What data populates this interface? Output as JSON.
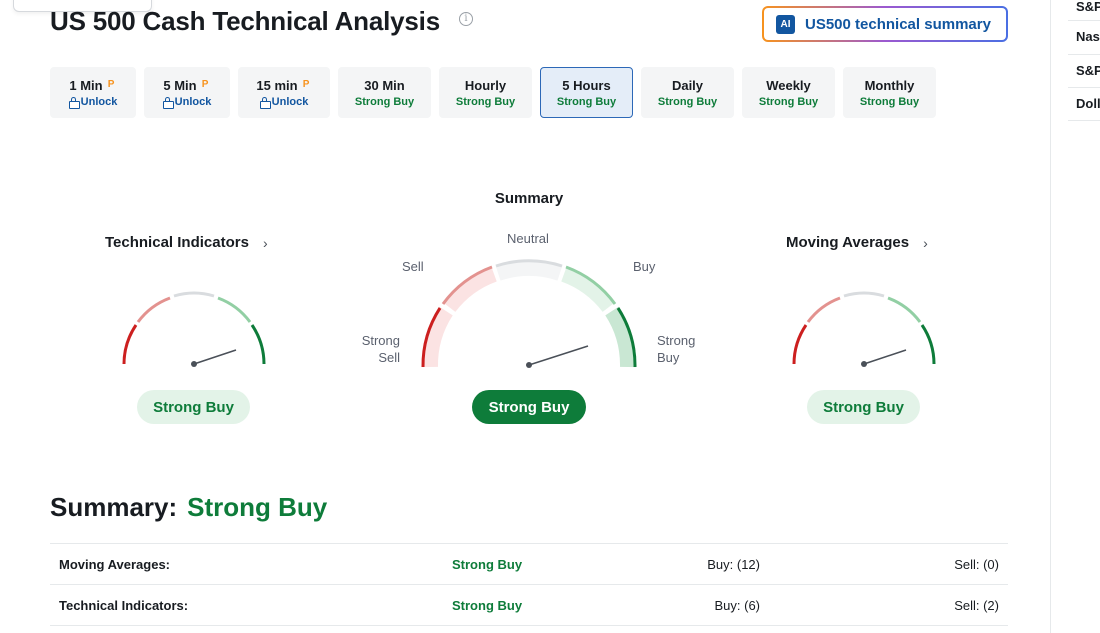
{
  "page": {
    "title": "US 500 Cash Technical Analysis",
    "info_icon": "info-icon"
  },
  "ai_summary": {
    "badge": "AI",
    "label": "US500 technical summary"
  },
  "colors": {
    "strong_buy": "#0e7c3a",
    "link_blue": "#1256a0",
    "pro_orange": "#f7931e"
  },
  "timeframes": [
    {
      "label": "1 Min",
      "status": "Unlock",
      "locked": true,
      "active": false
    },
    {
      "label": "5 Min",
      "status": "Unlock",
      "locked": true,
      "active": false
    },
    {
      "label": "15 min",
      "status": "Unlock",
      "locked": true,
      "active": false
    },
    {
      "label": "30 Min",
      "status": "Strong Buy",
      "locked": false,
      "active": false
    },
    {
      "label": "Hourly",
      "status": "Strong Buy",
      "locked": false,
      "active": false
    },
    {
      "label": "5 Hours",
      "status": "Strong Buy",
      "locked": false,
      "active": true
    },
    {
      "label": "Daily",
      "status": "Strong Buy",
      "locked": false,
      "active": false
    },
    {
      "label": "Weekly",
      "status": "Strong Buy",
      "locked": false,
      "active": false
    },
    {
      "label": "Monthly",
      "status": "Strong Buy",
      "locked": false,
      "active": false
    }
  ],
  "gauges": {
    "technical_indicators": {
      "title": "Technical Indicators",
      "result": "Strong Buy"
    },
    "summary": {
      "title": "Summary",
      "result": "Strong Buy",
      "labels": {
        "strong_sell": "Strong\nSell",
        "sell": "Sell",
        "neutral": "Neutral",
        "buy": "Buy",
        "strong_buy": "Strong\nBuy"
      }
    },
    "moving_averages": {
      "title": "Moving Averages",
      "result": "Strong Buy"
    }
  },
  "summary": {
    "heading": "Summary:",
    "value": "Strong Buy",
    "rows": [
      {
        "label": "Moving Averages:",
        "status": "Strong Buy",
        "buy": "Buy: (12)",
        "sell": "Sell: (0)"
      },
      {
        "label": "Technical Indicators:",
        "status": "Strong Buy",
        "buy": "Buy: (6)",
        "sell": "Sell: (2)"
      }
    ]
  },
  "sidebar": {
    "items": [
      "S&P",
      "Nas",
      "S&P",
      "Doll"
    ]
  }
}
